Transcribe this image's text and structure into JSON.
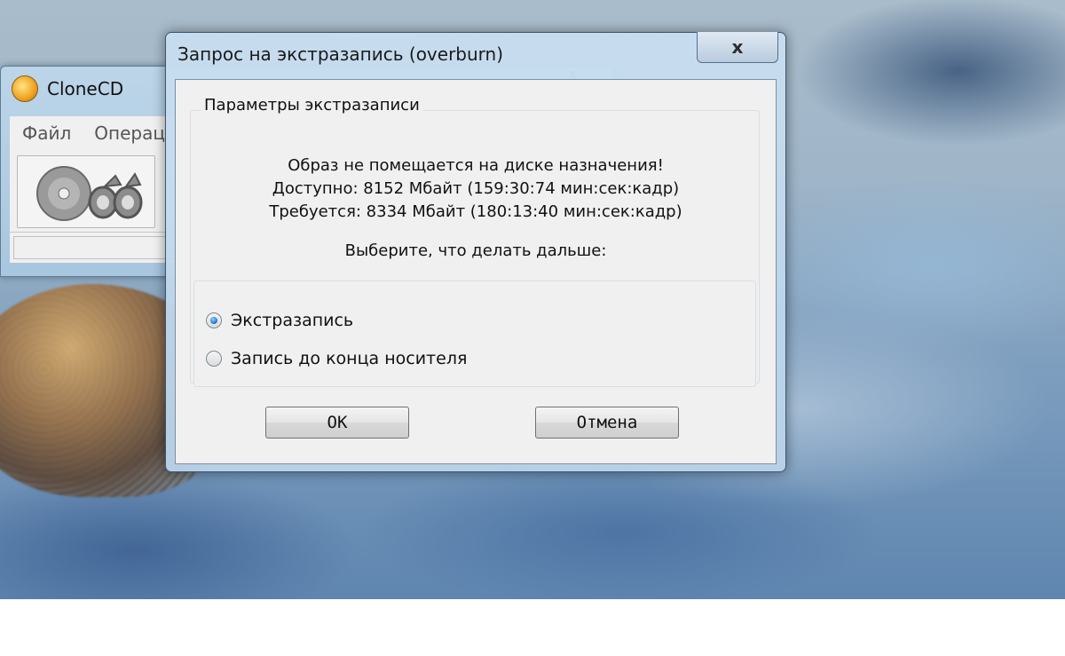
{
  "clonecd": {
    "title": "CloneCD",
    "menu": [
      "Файл",
      "Операц"
    ]
  },
  "dialog": {
    "title": "Запрос на экстразапись (overburn)",
    "close_label": "x",
    "group_title": "Параметры экстразаписи",
    "messages": [
      "Образ не помещается на диске назначения!",
      "Доступно: 8152 Мбайт (159:30:74 мин:сек:кадр)",
      "Требуется: 8334 Мбайт (180:13:40 мин:сек:кадр)"
    ],
    "prompt": "Выберите, что делать дальше:",
    "options": [
      {
        "label": "Экстразапись",
        "selected": true
      },
      {
        "label": "Запись до конца носителя",
        "selected": false
      }
    ],
    "ok_label": "OK",
    "cancel_label": "Отмена"
  },
  "icons": {
    "app": "clonecd-sheep-logo-icon",
    "toolbar": "disc-copy-icon",
    "close": "close-icon"
  },
  "colors": {
    "radio_selected": "#1a6fc4",
    "dialog_frame": "#c8dcef"
  }
}
